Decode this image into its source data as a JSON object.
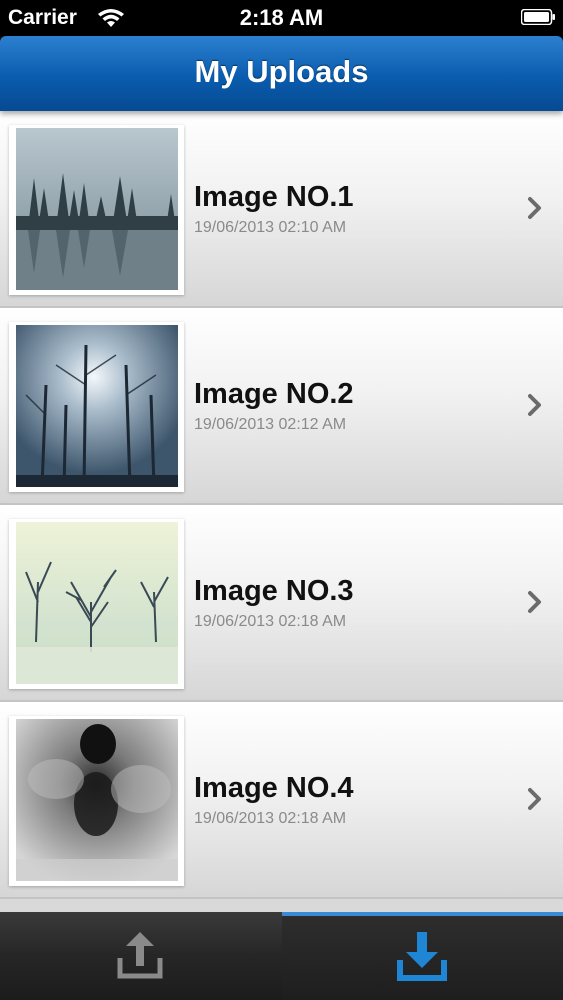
{
  "status_bar": {
    "carrier": "Carrier",
    "time": "2:18 AM",
    "wifi_icon": "wifi-icon",
    "battery_icon": "battery-icon"
  },
  "nav": {
    "title": "My Uploads",
    "bar_color": "#0a5cae"
  },
  "uploads": [
    {
      "title": "Image NO.1",
      "date": "19/06/2013 02:10 AM",
      "thumbnail": "misty-lake-forest"
    },
    {
      "title": "Image NO.2",
      "date": "19/06/2013 02:12 AM",
      "thumbnail": "sunrays-through-trees"
    },
    {
      "title": "Image NO.3",
      "date": "19/06/2013 02:18 AM",
      "thumbnail": "foggy-bare-trees"
    },
    {
      "title": "Image NO.4",
      "date": "19/06/2013 02:18 AM",
      "thumbnail": "the-fog-poster"
    }
  ],
  "tab_bar": {
    "tabs": [
      {
        "name": "upload",
        "icon": "upload-icon",
        "selected": false
      },
      {
        "name": "download",
        "icon": "download-icon",
        "selected": true
      }
    ],
    "selected_color": "#1f86d6"
  }
}
